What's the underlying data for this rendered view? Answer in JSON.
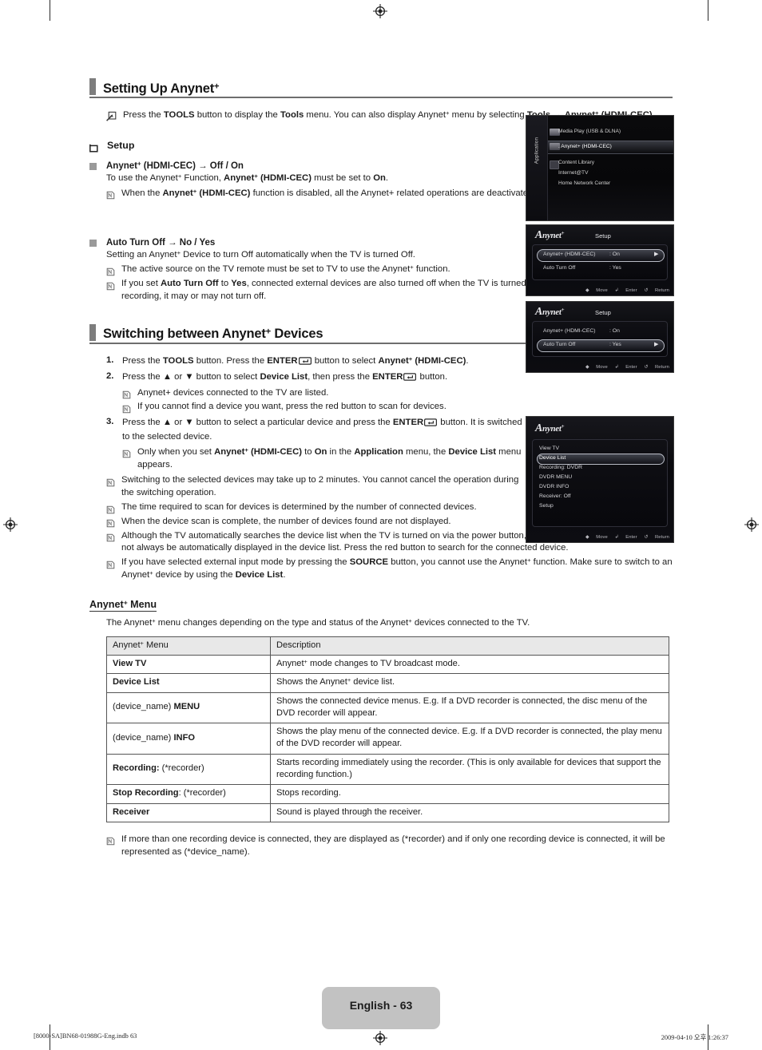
{
  "page": {
    "badge_label": "English - 63",
    "footer_left": "[8000-SA]BN68-01988G-Eng.indb   63",
    "footer_right": "2009-04-10   오후 1:26:37"
  },
  "section1": {
    "title_pre": "Setting Up Anynet",
    "title_sup": "+",
    "tools_note": {
      "t1": "Press the ",
      "b1": "TOOLS",
      "t2": " button to display the ",
      "b2": "Tools",
      "t3": " menu. You can also display Anynet",
      "sup3": "+",
      "t4": " menu by selecting ",
      "b3": "Tools",
      "t5": " → ",
      "b4": "Anynet",
      "sup4": "+",
      "b5": " (HDMI-CEC)",
      "t6": "."
    },
    "setup_heading": "Setup",
    "item1": {
      "heading_a": "Anynet",
      "heading_sup": "+",
      "heading_b": " (HDMI-CEC) → Off / On",
      "line_a": "To use the Anynet",
      "line_sup": "+",
      "line_b": " Function, ",
      "line_bold1": "Anynet",
      "line_bold1_sup": "+",
      "line_bold2": " (HDMI-CEC)",
      "line_c": " must be set to ",
      "line_bold3": "On",
      "line_d": ".",
      "note_a": "When the ",
      "note_bold1": "Anynet",
      "note_bold1_sup": "+",
      "note_bold2": " (HDMI-CEC)",
      "note_b": " function is disabled, all the Anynet+ related operations are deactivated."
    },
    "item2": {
      "heading": "Auto Turn Off → No / Yes",
      "line_a": "Setting an Anynet",
      "line_sup": "+",
      "line_b": " Device to turn Off automatically when the TV is turned Off.",
      "note1_a": "The active source on the TV remote must be set to TV to use the Anynet",
      "note1_sup": "+",
      "note1_b": " function.",
      "note2_a": "If you set ",
      "note2_bold1": "Auto Turn Off",
      "note2_b": " to ",
      "note2_bold2": "Yes",
      "note2_c": ", connected external devices are also turned off when the TV is turned off. If an external device is still recording, it may or may not turn off."
    }
  },
  "section2": {
    "title_pre": "Switching between Anynet",
    "title_sup": "+",
    "title_post": " Devices",
    "steps": [
      {
        "num": "1.",
        "frag": [
          {
            "t": "Press the ",
            "bold": false
          },
          {
            "t": "TOOLS",
            "bold": true
          },
          {
            "t": " button. Press the ",
            "bold": false
          },
          {
            "t": "ENTER",
            "bold": true
          },
          {
            "t": "ENTERKEY",
            "bold": false
          },
          {
            "t": " button to select ",
            "bold": false
          },
          {
            "t": "Anynet+ (HDMI-CEC)",
            "bold": true
          },
          {
            "t": ".",
            "bold": false
          }
        ]
      },
      {
        "num": "2.",
        "frag": [
          {
            "t": "Press the ▲ or ▼ button to select ",
            "bold": false
          },
          {
            "t": "Device List",
            "bold": true
          },
          {
            "t": ", then press the ",
            "bold": false
          },
          {
            "t": "ENTER",
            "bold": true
          },
          {
            "t": "ENTERKEY",
            "bold": false
          },
          {
            "t": " button.",
            "bold": false
          }
        ]
      },
      {
        "num": "3.",
        "frag": [
          {
            "t": "Press the ▲ or ▼ button to select a particular device and press the ",
            "bold": false
          },
          {
            "t": "ENTER",
            "bold": true
          },
          {
            "t": "ENTERKEY",
            "bold": false
          },
          {
            "t": " button. It is switched to the selected device.",
            "bold": false
          }
        ]
      }
    ],
    "step2_notes": [
      "Anynet+ devices connected to the TV are listed.",
      "If you cannot find a device you want, press the red button to scan for devices."
    ],
    "step3_note": {
      "a": "Only when you set ",
      "bold1": "Anynet",
      "bold1_sup": "+",
      "bold2": " (HDMI-CEC)",
      "b": " to ",
      "bold3": "On",
      "c": " in the ",
      "bold4": "Application",
      "d": " menu, the ",
      "bold5": "Device List",
      "e": " menu appears."
    },
    "notes": [
      "Switching to the selected devices may take up to 2 minutes. You cannot cancel the operation during the switching operation.",
      "The time required to scan for devices is determined by the number of connected devices.",
      "When the device scan is complete, the number of devices found are not displayed.",
      "Although the TV automatically searches the device list when the TV is turned on via the power button, devices connected to the TV may not always be automatically displayed in the device list. Press the red button to search for the connected device."
    ],
    "source_note": {
      "a": "If you have selected external input mode by pressing the ",
      "bold1": "SOURCE",
      "b": " button, you cannot use the Anynet",
      "sup": "+",
      "c": " function. Make sure to switch to an Anynet",
      "sup2": "+",
      "d": " device by using the ",
      "bold2": "Device List",
      "e": "."
    }
  },
  "menu_section": {
    "heading_pre": "Anynet",
    "heading_sup": "+",
    "heading_post": " Menu",
    "intro_a": "The Anynet",
    "intro_sup1": "+",
    "intro_b": " menu changes depending on the type and status of the Anynet",
    "intro_sup2": "+",
    "intro_c": " devices connected to the TV.",
    "table": {
      "headers": [
        "Anynet+ Menu",
        "Description"
      ],
      "header_col1_pre": "Anynet",
      "header_col1_sup": "+",
      "header_col1_post": " Menu",
      "rows": [
        {
          "menu_bold": "View TV",
          "menu_plain": "",
          "desc_a": "Anynet",
          "desc_sup": "+",
          "desc_b": " mode changes to TV broadcast mode."
        },
        {
          "menu_bold": "Device List",
          "menu_plain": "",
          "desc_a": "Shows the Anynet",
          "desc_sup": "+",
          "desc_b": " device list."
        },
        {
          "menu_bold": "MENU",
          "menu_plain": "(device_name) ",
          "menu_order": "plain-first",
          "desc_a": "Shows the connected device menus. E.g. If a DVD recorder is connected, the disc menu of the DVD recorder will appear.",
          "desc_sup": "",
          "desc_b": ""
        },
        {
          "menu_bold": "INFO",
          "menu_plain": "(device_name) ",
          "menu_order": "plain-first",
          "desc_a": "Shows the play menu of the connected device. E.g. If a DVD recorder is connected, the play menu of the DVD recorder will appear.",
          "desc_sup": "",
          "desc_b": ""
        },
        {
          "menu_bold": "Recording:",
          "menu_plain": " (*recorder)",
          "menu_order": "bold-first",
          "desc_a": "Starts recording immediately using the recorder. (This is only available for devices that support the recording function.)",
          "desc_sup": "",
          "desc_b": ""
        },
        {
          "menu_bold": "Stop Recording",
          "menu_plain": ": (*recorder)",
          "menu_order": "bold-first",
          "desc_a": "Stops recording.",
          "desc_sup": "",
          "desc_b": ""
        },
        {
          "menu_bold": "Receiver",
          "menu_plain": "",
          "menu_order": "bold-first",
          "desc_a": "Sound is played through the receiver.",
          "desc_sup": "",
          "desc_b": ""
        }
      ]
    },
    "final_note": "If more than one recording device is connected, they are displayed as (*recorder) and if only one recording device is connected, it will be represented as (*device_name)."
  },
  "osd": {
    "application": {
      "sidebar_label": "Application",
      "items": [
        "Media Play (USB & DLNA)",
        ". Anynet+ (HDMI-CEC)",
        "Content Library",
        "Internet@TV",
        "Home Network Center"
      ],
      "selected_index": 1
    },
    "setup1": {
      "logo": "Anynet",
      "logo_sup": "+",
      "title": "Setup",
      "rows": [
        {
          "label": "Anynet+ (HDMI-CEC)",
          "value": ": On"
        },
        {
          "label": "Auto Turn Off",
          "value": ": Yes"
        }
      ],
      "selected_index": 0,
      "footer": [
        "Move",
        "Enter",
        "Return"
      ]
    },
    "setup2": {
      "logo": "Anynet",
      "logo_sup": "+",
      "title": "Setup",
      "rows": [
        {
          "label": "Anynet+ (HDMI-CEC)",
          "value": ": On"
        },
        {
          "label": "Auto Turn Off",
          "value": ": Yes"
        }
      ],
      "selected_index": 1,
      "footer": [
        "Move",
        "Enter",
        "Return"
      ]
    },
    "device_list": {
      "logo": "Anynet",
      "logo_sup": "+",
      "items": [
        "View TV",
        "Device List",
        "Recording: DVDR",
        "DVDR MENU",
        "DVDR INFO",
        "Receiver: Off",
        "Setup"
      ],
      "selected_index": 1,
      "footer": [
        "Move",
        "Enter",
        "Return"
      ]
    }
  }
}
